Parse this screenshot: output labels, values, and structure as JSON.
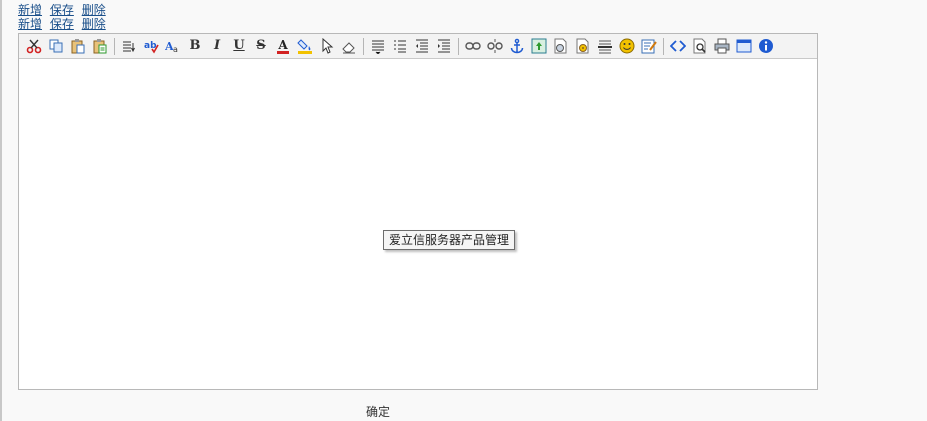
{
  "links_row1": [
    "新增",
    "保存",
    "删除"
  ],
  "links_row2": [
    "新增",
    "保存",
    "删除"
  ],
  "toolbar": {
    "bold": "B",
    "italic": "I",
    "underline": "U",
    "strike": "S",
    "forecolor": "A"
  },
  "tooltip": "爱立信服务器产品管理",
  "confirm_label": "确定",
  "colors": {
    "link": "#1a4f8a",
    "cut_red": "#d22222",
    "smiley_yellow": "#f2c200",
    "info_blue": "#1f5bd1"
  }
}
